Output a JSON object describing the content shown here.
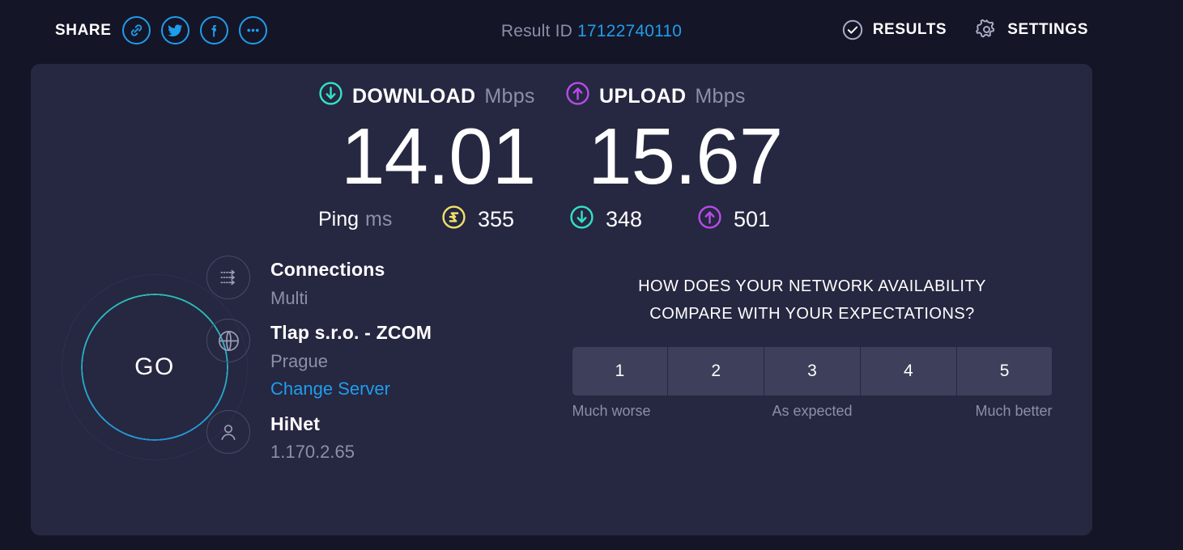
{
  "header": {
    "share_label": "SHARE",
    "share_icons": [
      "link-icon",
      "twitter-icon",
      "facebook-icon",
      "more-icon"
    ],
    "result_id_label": "Result ID",
    "result_id_value": "17122740110",
    "results_label": "RESULTS",
    "settings_label": "SETTINGS"
  },
  "speeds": {
    "download": {
      "name": "DOWNLOAD",
      "unit": "Mbps",
      "value": "14.01",
      "icon": "download-arrow-icon",
      "color": "#33e0c4"
    },
    "upload": {
      "name": "UPLOAD",
      "unit": "Mbps",
      "value": "15.67",
      "icon": "upload-arrow-icon",
      "color": "#b44ce8"
    }
  },
  "ping": {
    "label": "Ping",
    "unit": "ms",
    "idle": {
      "value": "355",
      "icon": "idle-latency-icon",
      "color": "#f0e06a"
    },
    "download": {
      "value": "348",
      "icon": "download-arrow-icon",
      "color": "#33e0c4"
    },
    "upload": {
      "value": "501",
      "icon": "upload-arrow-icon",
      "color": "#b44ce8"
    }
  },
  "go_button": {
    "label": "GO"
  },
  "info": {
    "connections": {
      "icon": "multi-connections-icon",
      "title": "Connections",
      "sub": "Multi"
    },
    "server": {
      "icon": "globe-icon",
      "title": "Tlap s.r.o. - ZCOM",
      "sub": "Prague",
      "link": "Change Server"
    },
    "isp": {
      "icon": "person-icon",
      "title": "HiNet",
      "sub": "1.170.2.65"
    }
  },
  "survey": {
    "question_line1": "HOW DOES YOUR NETWORK AVAILABILITY",
    "question_line2": "COMPARE WITH YOUR EXPECTATIONS?",
    "options": [
      "1",
      "2",
      "3",
      "4",
      "5"
    ],
    "legend_left": "Much worse",
    "legend_center": "As expected",
    "legend_right": "Much better"
  },
  "colors": {
    "page_bg": "#141527",
    "panel_bg": "#262740",
    "accent_blue": "#1f9ded",
    "teal": "#33e0c4",
    "purple": "#b44ce8",
    "yellow": "#f0e06a",
    "muted_text": "#8b8fa8"
  }
}
